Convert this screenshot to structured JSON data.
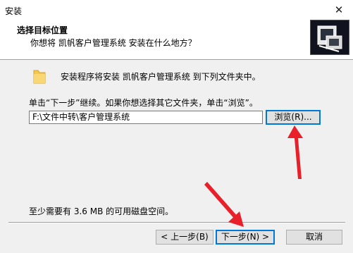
{
  "window": {
    "title": "安装",
    "close_label": "✕"
  },
  "header": {
    "title": "选择目标位置",
    "subtitle": "你想将 凯帆客户管理系统 安装在什么地方？"
  },
  "content": {
    "install_text": "安装程序将安装 凯帆客户管理系统 到下列文件夹中。",
    "instruction_text": "单击“下一步”继续。如果你想选择其它文件夹，单击“浏览”。",
    "path_value": "F:\\文件中转\\客户管理系统",
    "browse_label": "浏览(R)...",
    "space_text": "至少需要有 3.6 MB 的可用磁盘空间。"
  },
  "footer": {
    "back_label": "< 上一步(B)",
    "next_label": "下一步(N) >",
    "cancel_label": "取消"
  },
  "colors": {
    "annotation_arrow": "#e8202a",
    "focus_border": "#0078d7"
  }
}
